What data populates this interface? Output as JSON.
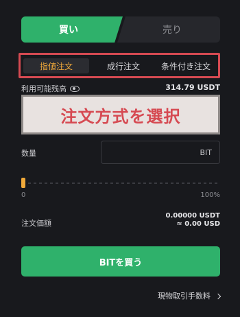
{
  "toggle": {
    "buy": "買い",
    "sell": "売り"
  },
  "order_types": [
    {
      "label": "指値注文",
      "active": true
    },
    {
      "label": "成行注文",
      "active": false
    },
    {
      "label": "条件付き注文",
      "active": false
    }
  ],
  "balance": {
    "label": "利用可能残高",
    "value": "314.79 USDT",
    "icon": "eye-icon"
  },
  "annotation": {
    "text": "注文方式を選択"
  },
  "quantity": {
    "label": "数量",
    "unit": "BIT",
    "value": ""
  },
  "slider": {
    "min_label": "0",
    "max_label": "100%",
    "percent": 0
  },
  "order_price": {
    "label": "注文価額",
    "usdt": "0.00000 USDT",
    "usd": "≈ 0.00 USD"
  },
  "buy_button": {
    "label": "BITを買う"
  },
  "fee_link": {
    "label": "現物取引手数料",
    "icon": "chevron-right-icon"
  },
  "colors": {
    "accent_green": "#2fb16b",
    "highlight_orange": "#f0a93a",
    "annotation_red": "#d64a52",
    "background": "#18191d"
  }
}
